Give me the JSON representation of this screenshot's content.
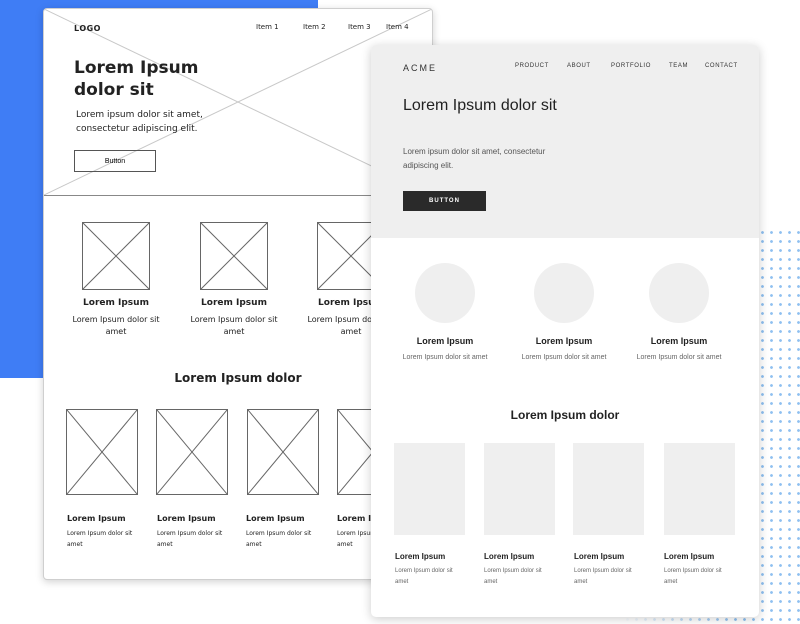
{
  "colors": {
    "accent_blue": "#3f7df5",
    "dot_blue": "#8fc0f0",
    "button_dark": "#2a2a2a",
    "placeholder_gray": "#efefef"
  },
  "sketch": {
    "logo": "LOGO",
    "nav": [
      "Item 1",
      "Item 2",
      "Item 3",
      "Item 4"
    ],
    "hero_title": "Lorem Ipsum dolor sit",
    "hero_text": "Lorem ipsum dolor sit amet, consectetur adipiscing elit.",
    "hero_button": "Button",
    "features": [
      {
        "title": "Lorem Ipsum",
        "text": "Lorem Ipsum dolor sit amet"
      },
      {
        "title": "Lorem Ipsum",
        "text": "Lorem Ipsum dolor sit amet"
      },
      {
        "title": "Lorem Ipsum",
        "text": "Lorem Ipsum dolor sit amet"
      }
    ],
    "section_title": "Lorem Ipsum dolor",
    "gallery": [
      {
        "title": "Lorem Ipsum",
        "text": "Lorem Ipsum dolor sit amet"
      },
      {
        "title": "Lorem Ipsum",
        "text": "Lorem Ipsum dolor sit amet"
      },
      {
        "title": "Lorem Ipsum",
        "text": "Lorem Ipsum dolor sit amet"
      },
      {
        "title": "Lorem Ipsum",
        "text": "Lorem Ipsum dolor sit amet"
      }
    ]
  },
  "clean": {
    "logo": "ACME",
    "nav": [
      "PRODUCT",
      "ABOUT",
      "PORTFOLIO",
      "TEAM",
      "CONTACT"
    ],
    "hero_title": "Lorem Ipsum dolor sit",
    "hero_text": "Lorem ipsum dolor sit amet, consectetur adipiscing elit.",
    "hero_button": "BUTTON",
    "features": [
      {
        "title": "Lorem Ipsum",
        "text": "Lorem Ipsum dolor sit amet"
      },
      {
        "title": "Lorem Ipsum",
        "text": "Lorem Ipsum dolor sit amet"
      },
      {
        "title": "Lorem Ipsum",
        "text": "Lorem Ipsum dolor sit amet"
      }
    ],
    "section_title": "Lorem Ipsum dolor",
    "gallery": [
      {
        "title": "Lorem Ipsum",
        "text": "Lorem Ipsum dolor sit amet"
      },
      {
        "title": "Lorem Ipsum",
        "text": "Lorem Ipsum dolor sit amet"
      },
      {
        "title": "Lorem Ipsum",
        "text": "Lorem Ipsum dolor sit amet"
      },
      {
        "title": "Lorem Ipsum",
        "text": "Lorem Ipsum dolor sit amet"
      }
    ]
  }
}
